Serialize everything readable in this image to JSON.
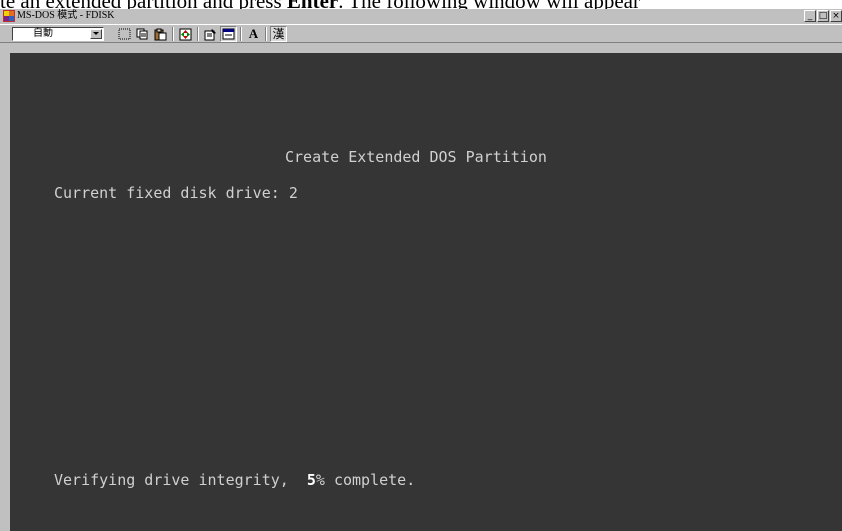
{
  "document": {
    "text_before": "te an extended partition and press ",
    "bold_word": "Enter",
    "text_after": ". The following window will appear"
  },
  "window": {
    "title": "MS-DOS 模式 - FDISK",
    "controls": {
      "minimize": "_",
      "maximize": "□",
      "close": "×"
    },
    "toolbar": {
      "font_size_select": "自動",
      "buttons": [
        {
          "name": "mark",
          "icon": "mark-icon"
        },
        {
          "name": "copy",
          "icon": "copy-icon"
        },
        {
          "name": "paste",
          "icon": "paste-icon"
        },
        {
          "name": "fullscreen",
          "icon": "fullscreen-icon"
        },
        {
          "name": "properties",
          "icon": "properties-icon"
        },
        {
          "name": "background",
          "icon": "background-icon"
        },
        {
          "name": "font",
          "icon": "font-icon",
          "label": "A"
        },
        {
          "name": "ime",
          "icon": "ime-icon",
          "label": "漢"
        }
      ]
    }
  },
  "console": {
    "heading": "Create Extended DOS Partition",
    "drive_label": "Current fixed disk drive: ",
    "drive_value": "2",
    "progress_prefix": "Verifying drive integrity,  ",
    "progress_percent": "5",
    "progress_suffix": "% complete."
  },
  "colors": {
    "console_background": "#353535",
    "console_text": "#d0d0d0",
    "chrome": "#c0c0c0"
  }
}
